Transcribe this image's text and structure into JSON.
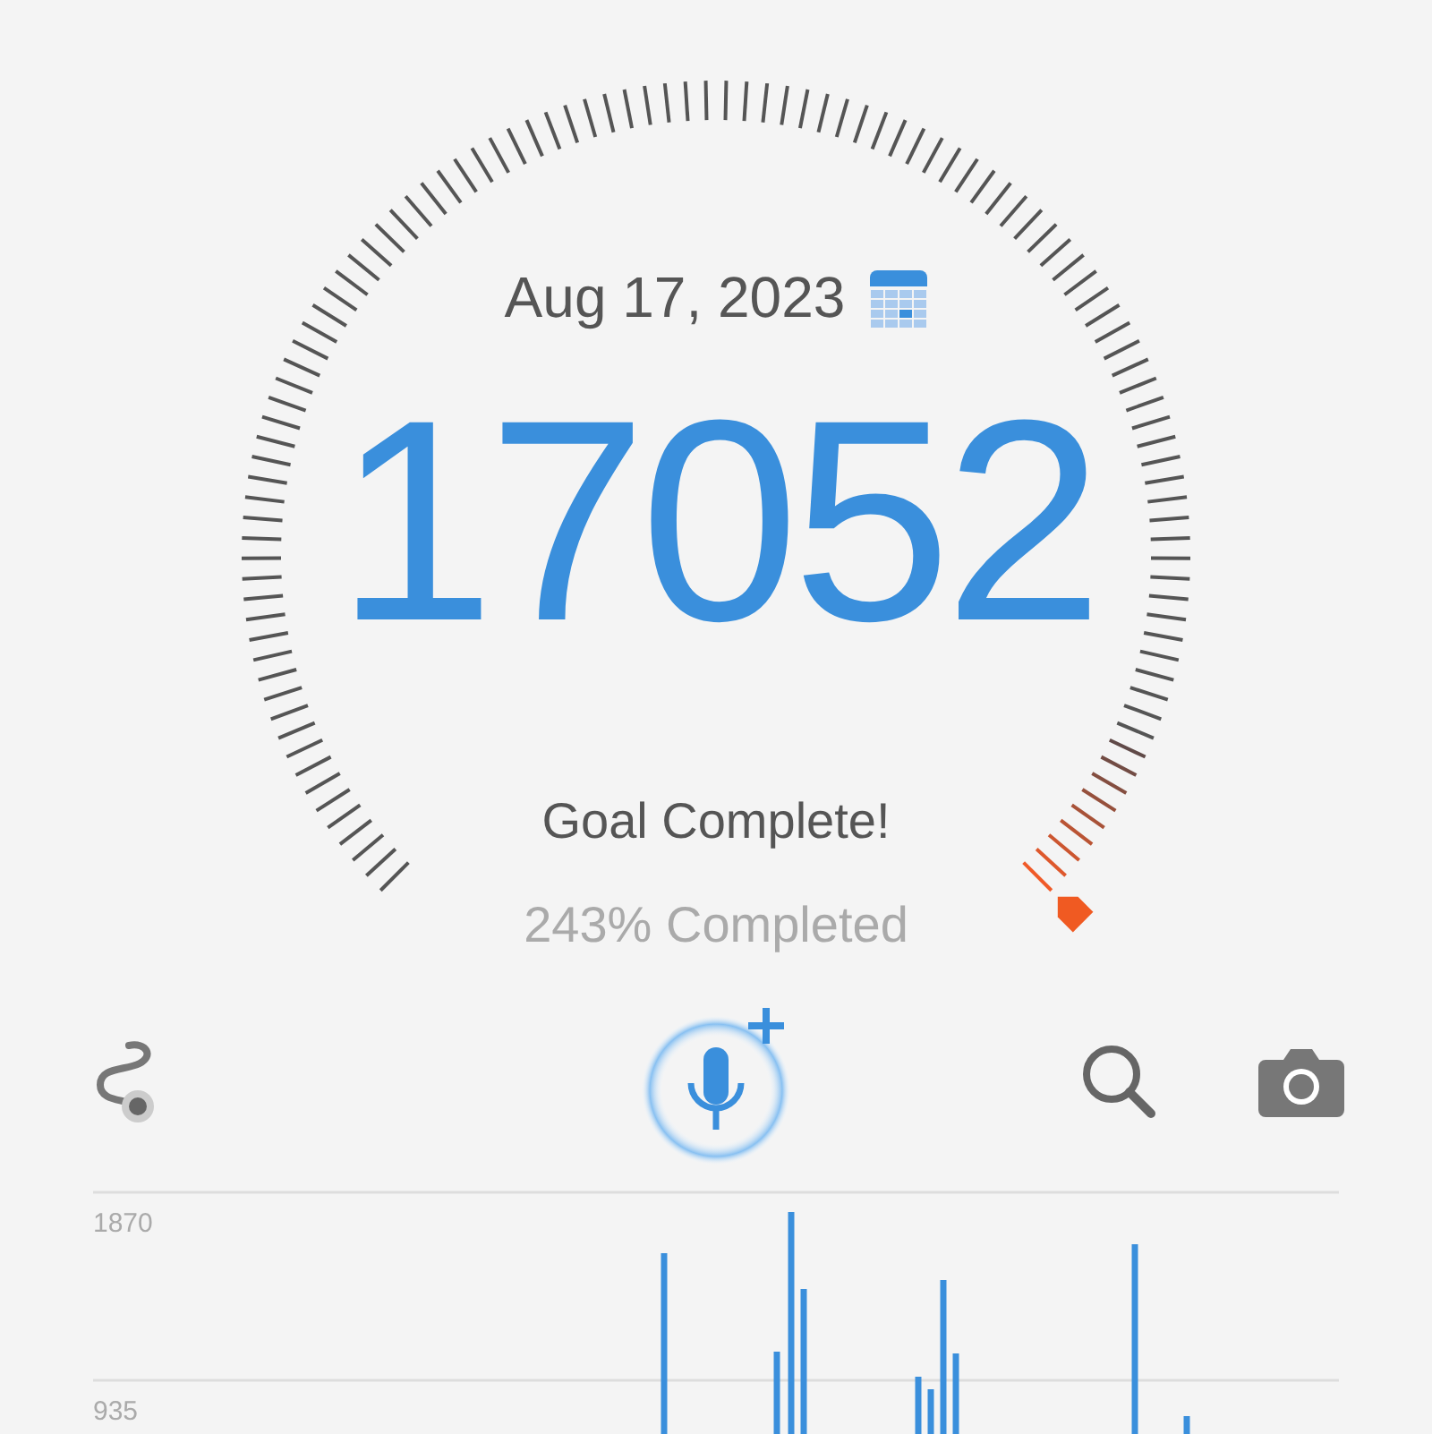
{
  "gauge": {
    "date": "Aug 17, 2023",
    "steps": "17052",
    "status": "Goal Complete!",
    "progress": "243% Completed"
  },
  "activity_chart": {
    "axis_labels": [
      "1870",
      "935"
    ]
  }
}
